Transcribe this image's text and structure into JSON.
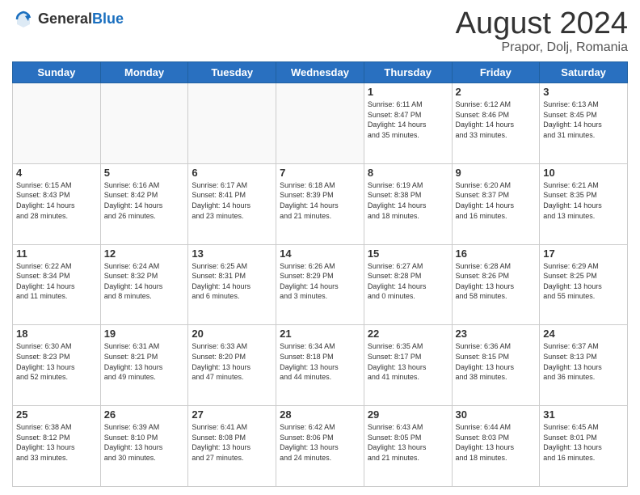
{
  "header": {
    "logo_general": "General",
    "logo_blue": "Blue",
    "title": "August 2024",
    "subtitle": "Prapor, Dolj, Romania"
  },
  "days_of_week": [
    "Sunday",
    "Monday",
    "Tuesday",
    "Wednesday",
    "Thursday",
    "Friday",
    "Saturday"
  ],
  "weeks": [
    [
      {
        "day": "",
        "info": ""
      },
      {
        "day": "",
        "info": ""
      },
      {
        "day": "",
        "info": ""
      },
      {
        "day": "",
        "info": ""
      },
      {
        "day": "1",
        "info": "Sunrise: 6:11 AM\nSunset: 8:47 PM\nDaylight: 14 hours\nand 35 minutes."
      },
      {
        "day": "2",
        "info": "Sunrise: 6:12 AM\nSunset: 8:46 PM\nDaylight: 14 hours\nand 33 minutes."
      },
      {
        "day": "3",
        "info": "Sunrise: 6:13 AM\nSunset: 8:45 PM\nDaylight: 14 hours\nand 31 minutes."
      }
    ],
    [
      {
        "day": "4",
        "info": "Sunrise: 6:15 AM\nSunset: 8:43 PM\nDaylight: 14 hours\nand 28 minutes."
      },
      {
        "day": "5",
        "info": "Sunrise: 6:16 AM\nSunset: 8:42 PM\nDaylight: 14 hours\nand 26 minutes."
      },
      {
        "day": "6",
        "info": "Sunrise: 6:17 AM\nSunset: 8:41 PM\nDaylight: 14 hours\nand 23 minutes."
      },
      {
        "day": "7",
        "info": "Sunrise: 6:18 AM\nSunset: 8:39 PM\nDaylight: 14 hours\nand 21 minutes."
      },
      {
        "day": "8",
        "info": "Sunrise: 6:19 AM\nSunset: 8:38 PM\nDaylight: 14 hours\nand 18 minutes."
      },
      {
        "day": "9",
        "info": "Sunrise: 6:20 AM\nSunset: 8:37 PM\nDaylight: 14 hours\nand 16 minutes."
      },
      {
        "day": "10",
        "info": "Sunrise: 6:21 AM\nSunset: 8:35 PM\nDaylight: 14 hours\nand 13 minutes."
      }
    ],
    [
      {
        "day": "11",
        "info": "Sunrise: 6:22 AM\nSunset: 8:34 PM\nDaylight: 14 hours\nand 11 minutes."
      },
      {
        "day": "12",
        "info": "Sunrise: 6:24 AM\nSunset: 8:32 PM\nDaylight: 14 hours\nand 8 minutes."
      },
      {
        "day": "13",
        "info": "Sunrise: 6:25 AM\nSunset: 8:31 PM\nDaylight: 14 hours\nand 6 minutes."
      },
      {
        "day": "14",
        "info": "Sunrise: 6:26 AM\nSunset: 8:29 PM\nDaylight: 14 hours\nand 3 minutes."
      },
      {
        "day": "15",
        "info": "Sunrise: 6:27 AM\nSunset: 8:28 PM\nDaylight: 14 hours\nand 0 minutes."
      },
      {
        "day": "16",
        "info": "Sunrise: 6:28 AM\nSunset: 8:26 PM\nDaylight: 13 hours\nand 58 minutes."
      },
      {
        "day": "17",
        "info": "Sunrise: 6:29 AM\nSunset: 8:25 PM\nDaylight: 13 hours\nand 55 minutes."
      }
    ],
    [
      {
        "day": "18",
        "info": "Sunrise: 6:30 AM\nSunset: 8:23 PM\nDaylight: 13 hours\nand 52 minutes."
      },
      {
        "day": "19",
        "info": "Sunrise: 6:31 AM\nSunset: 8:21 PM\nDaylight: 13 hours\nand 49 minutes."
      },
      {
        "day": "20",
        "info": "Sunrise: 6:33 AM\nSunset: 8:20 PM\nDaylight: 13 hours\nand 47 minutes."
      },
      {
        "day": "21",
        "info": "Sunrise: 6:34 AM\nSunset: 8:18 PM\nDaylight: 13 hours\nand 44 minutes."
      },
      {
        "day": "22",
        "info": "Sunrise: 6:35 AM\nSunset: 8:17 PM\nDaylight: 13 hours\nand 41 minutes."
      },
      {
        "day": "23",
        "info": "Sunrise: 6:36 AM\nSunset: 8:15 PM\nDaylight: 13 hours\nand 38 minutes."
      },
      {
        "day": "24",
        "info": "Sunrise: 6:37 AM\nSunset: 8:13 PM\nDaylight: 13 hours\nand 36 minutes."
      }
    ],
    [
      {
        "day": "25",
        "info": "Sunrise: 6:38 AM\nSunset: 8:12 PM\nDaylight: 13 hours\nand 33 minutes."
      },
      {
        "day": "26",
        "info": "Sunrise: 6:39 AM\nSunset: 8:10 PM\nDaylight: 13 hours\nand 30 minutes."
      },
      {
        "day": "27",
        "info": "Sunrise: 6:41 AM\nSunset: 8:08 PM\nDaylight: 13 hours\nand 27 minutes."
      },
      {
        "day": "28",
        "info": "Sunrise: 6:42 AM\nSunset: 8:06 PM\nDaylight: 13 hours\nand 24 minutes."
      },
      {
        "day": "29",
        "info": "Sunrise: 6:43 AM\nSunset: 8:05 PM\nDaylight: 13 hours\nand 21 minutes."
      },
      {
        "day": "30",
        "info": "Sunrise: 6:44 AM\nSunset: 8:03 PM\nDaylight: 13 hours\nand 18 minutes."
      },
      {
        "day": "31",
        "info": "Sunrise: 6:45 AM\nSunset: 8:01 PM\nDaylight: 13 hours\nand 16 minutes."
      }
    ]
  ]
}
